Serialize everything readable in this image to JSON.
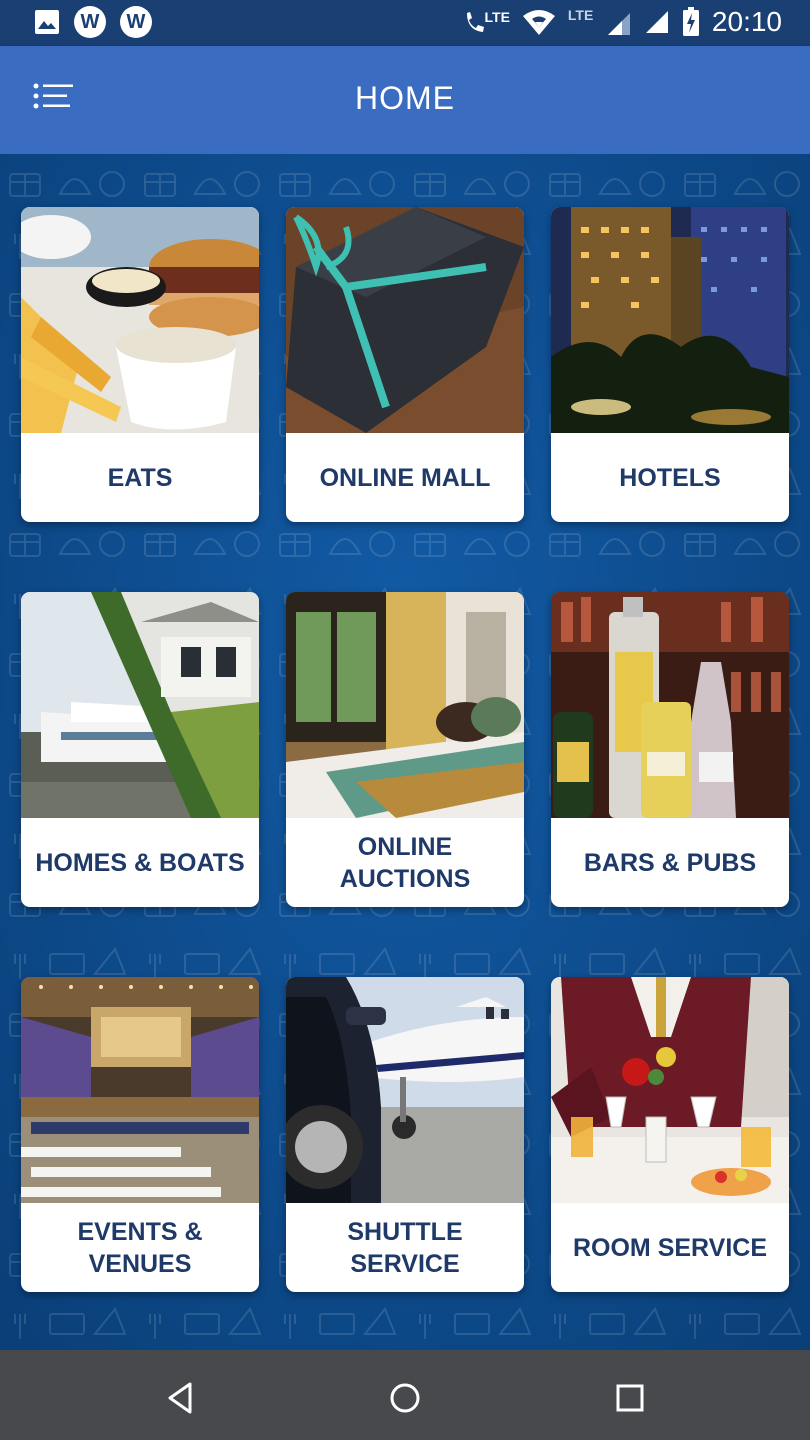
{
  "status_bar": {
    "time": "20:10",
    "left_icons": [
      "image-icon",
      "w-app-icon",
      "w-app-icon"
    ],
    "lte_call_label": "LTE",
    "lte_signal_label": "LTE",
    "w_letter": "W"
  },
  "app_bar": {
    "title": "HOME",
    "menu_icon": "menu-list-icon"
  },
  "colors": {
    "status_bar": "#1a3f73",
    "app_bar": "#3a6cc2",
    "background": "#0d4a8a",
    "card_text": "#1f3a68",
    "nav_bar": "#47494d"
  },
  "cards": [
    {
      "label": "EATS"
    },
    {
      "label": "ONLINE MALL"
    },
    {
      "label": "HOTELS"
    },
    {
      "label": "HOMES & BOATS"
    },
    {
      "label": "ONLINE\nAUCTIONS"
    },
    {
      "label": "BARS & PUBS"
    },
    {
      "label": "EVENTS &\nVENUES"
    },
    {
      "label": "SHUTTLE\nSERVICE"
    },
    {
      "label": "ROOM SERVICE"
    }
  ],
  "nav_bar": {
    "buttons": [
      "back-icon",
      "home-icon",
      "recents-icon"
    ]
  }
}
